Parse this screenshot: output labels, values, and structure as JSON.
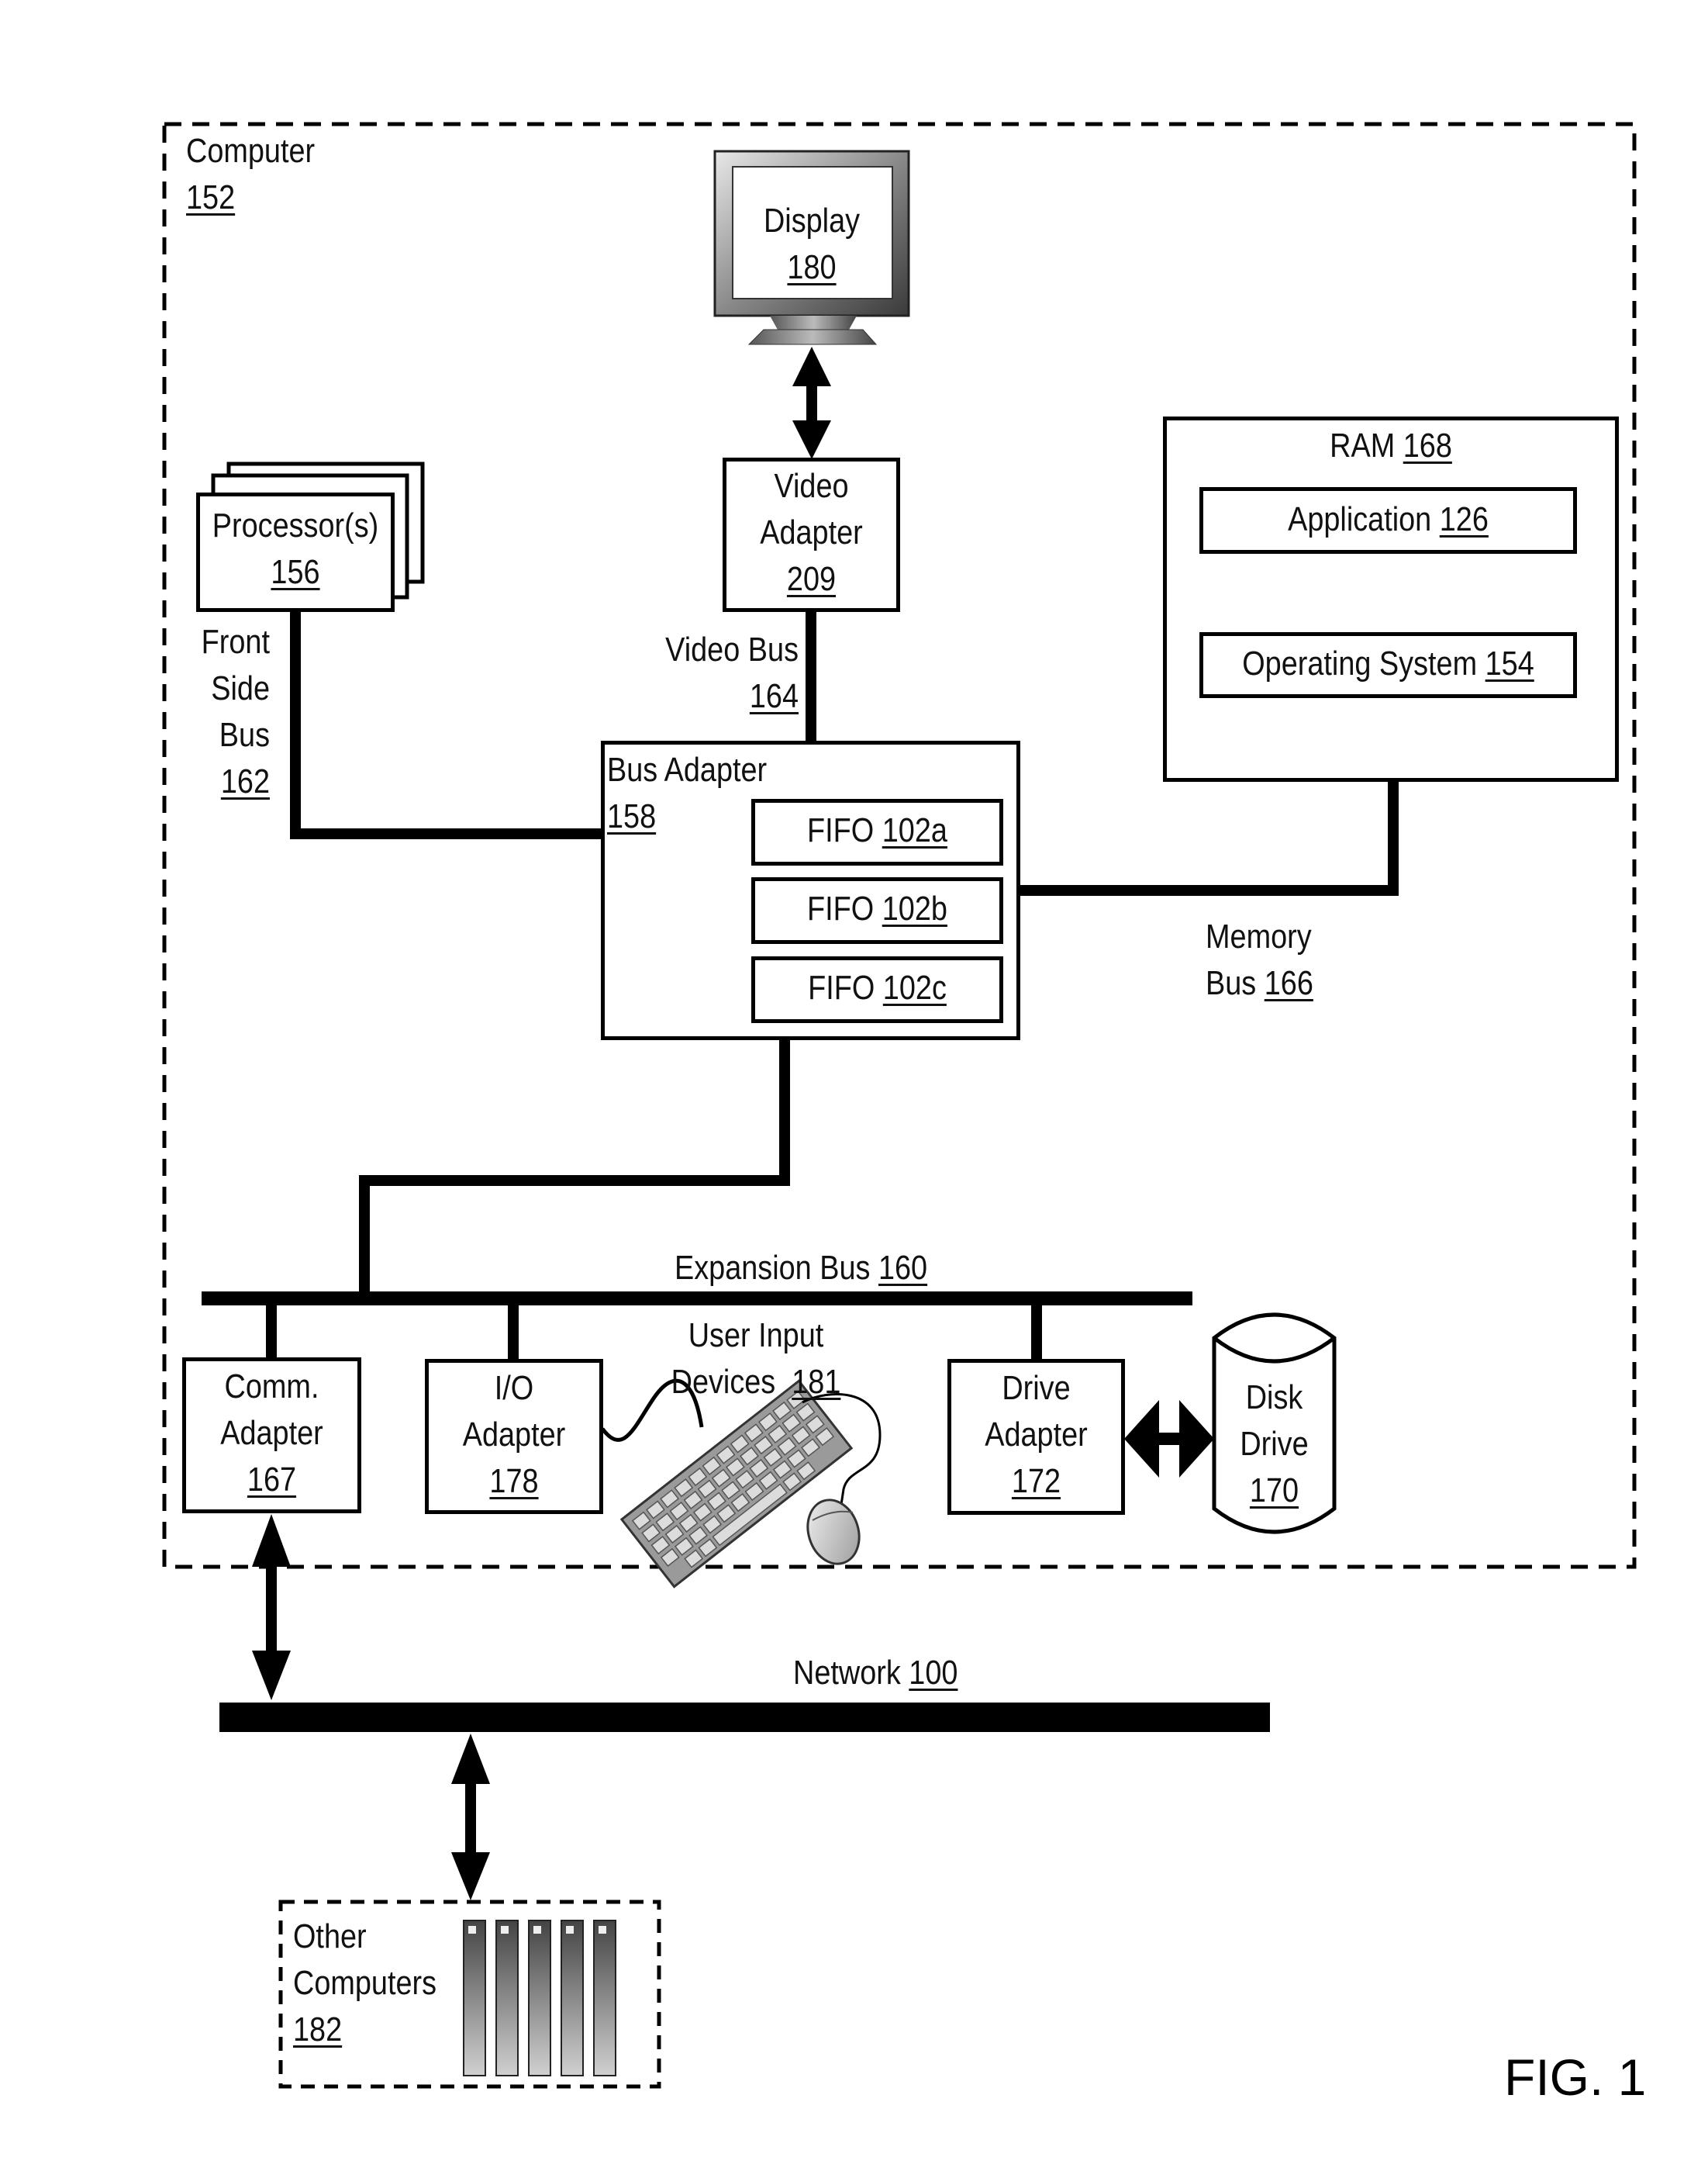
{
  "figure_label": "FIG. 1",
  "computer": {
    "name": "Computer",
    "ref": "152"
  },
  "display": {
    "name": "Display",
    "ref": "180",
    "icon": "monitor-icon"
  },
  "video_adapter": {
    "line1": "Video",
    "line2": "Adapter",
    "ref": "209"
  },
  "video_bus": {
    "name": "Video Bus",
    "ref": "164"
  },
  "processors": {
    "name": "Processor(s)",
    "ref": "156",
    "icon": "stacked-cards-icon"
  },
  "front_side_bus": {
    "line1": "Front",
    "line2": "Side",
    "line3": "Bus",
    "ref": "162"
  },
  "ram": {
    "name": "RAM",
    "ref": "168",
    "items": [
      {
        "name": "Application",
        "ref": "126"
      },
      {
        "name": "Operating System",
        "ref": "154"
      }
    ]
  },
  "memory_bus": {
    "line1": "Memory",
    "line2": "Bus",
    "ref": "166"
  },
  "bus_adapter": {
    "name": "Bus Adapter",
    "ref": "158",
    "fifos": [
      {
        "name": "FIFO",
        "ref": "102a"
      },
      {
        "name": "FIFO",
        "ref": "102b"
      },
      {
        "name": "FIFO",
        "ref": "102c"
      }
    ]
  },
  "expansion_bus": {
    "name": "Expansion Bus",
    "ref": "160"
  },
  "comm_adapter": {
    "line1": "Comm.",
    "line2": "Adapter",
    "ref": "167"
  },
  "io_adapter": {
    "line1": "I/O",
    "line2": "Adapter",
    "ref": "178"
  },
  "user_input_devices": {
    "line1": "User Input",
    "line2": "Devices",
    "ref": "181",
    "icons": [
      "keyboard-icon",
      "mouse-icon"
    ]
  },
  "drive_adapter": {
    "line1": "Drive",
    "line2": "Adapter",
    "ref": "172"
  },
  "disk_drive": {
    "line1": "Disk",
    "line2": "Drive",
    "ref": "170",
    "icon": "cylinder-icon"
  },
  "network": {
    "name": "Network",
    "ref": "100"
  },
  "other_computers": {
    "line1": "Other",
    "line2": "Computers",
    "ref": "182",
    "icon": "server-rack-icon"
  }
}
